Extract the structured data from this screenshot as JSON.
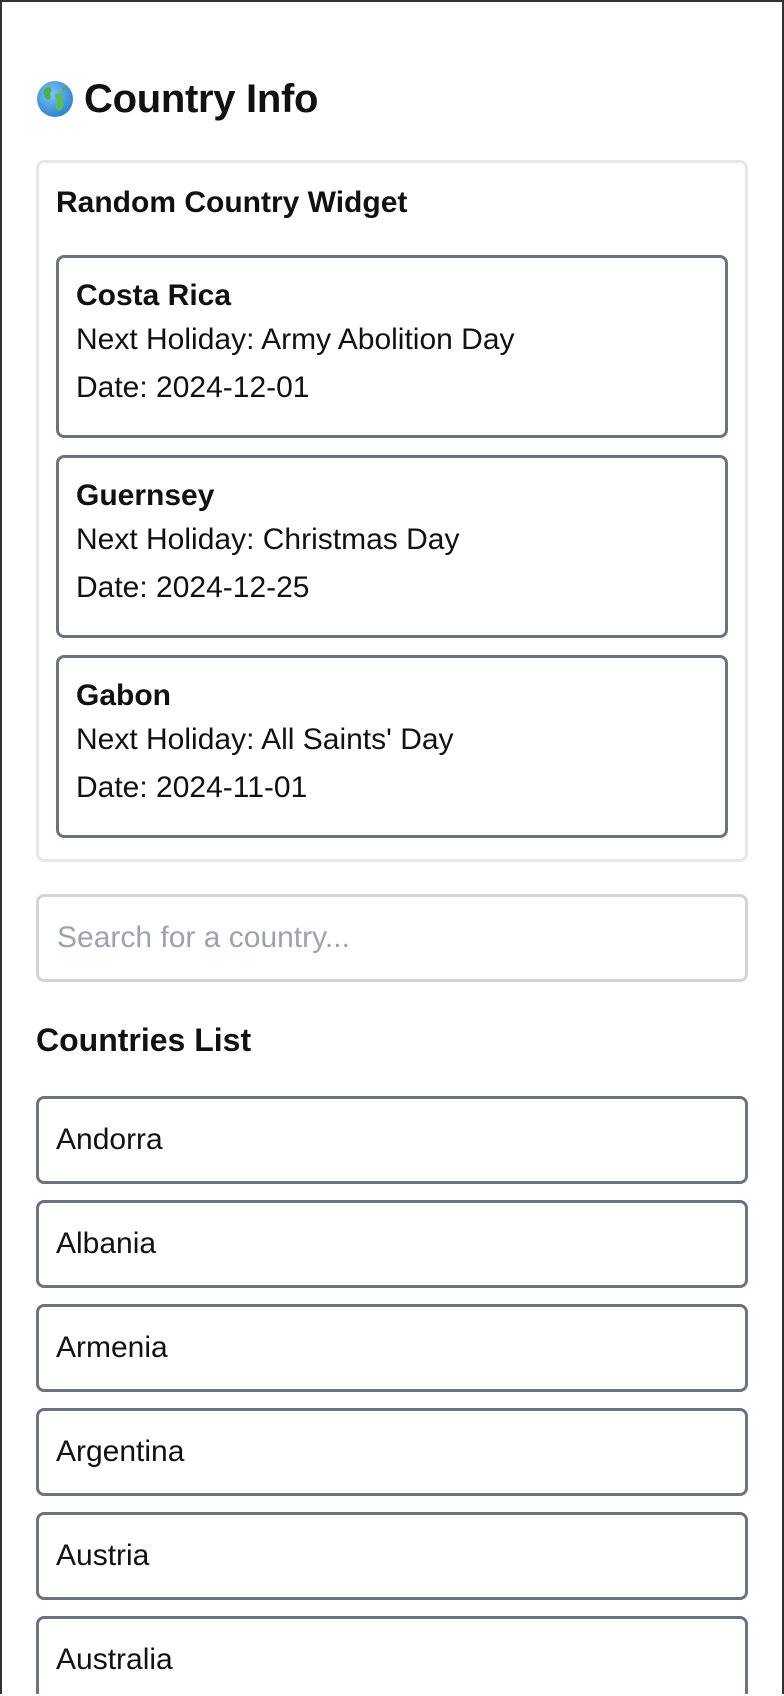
{
  "header": {
    "title": "Country Info",
    "icon": "globe-icon"
  },
  "widget": {
    "title": "Random Country Widget",
    "holiday_prefix": "Next Holiday: ",
    "date_prefix": "Date: ",
    "cards": [
      {
        "country": "Costa Rica",
        "holiday": "Next Holiday: Army Abolition Day",
        "date": "Date: 2024-12-01"
      },
      {
        "country": "Guernsey",
        "holiday": "Next Holiday: Christmas Day",
        "date": "Date: 2024-12-25"
      },
      {
        "country": "Gabon",
        "holiday": "Next Holiday: All Saints' Day",
        "date": "Date: 2024-11-01"
      }
    ]
  },
  "search": {
    "placeholder": "Search for a country...",
    "value": ""
  },
  "countries": {
    "heading": "Countries List",
    "items": [
      "Andorra",
      "Albania",
      "Armenia",
      "Argentina",
      "Austria",
      "Australia"
    ]
  },
  "colors": {
    "card_border": "#6b7280",
    "widget_border": "#e6e7ea",
    "input_border": "#d1d5db",
    "placeholder": "#9ca3af"
  }
}
